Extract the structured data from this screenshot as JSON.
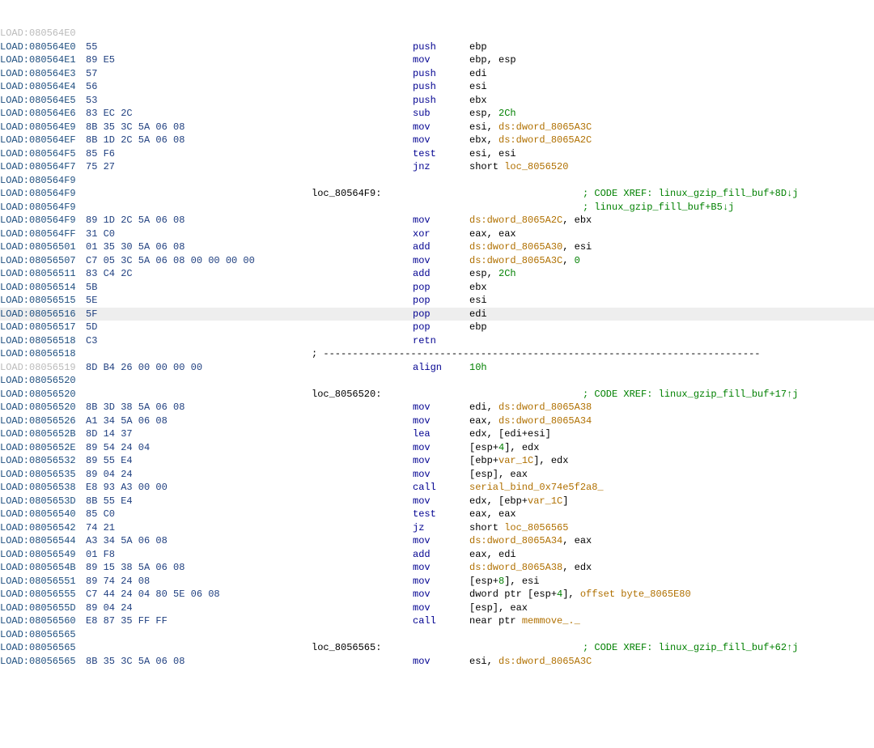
{
  "segPrefix": "LOAD:",
  "highlightIndex": 21,
  "columns": {
    "hex": 100,
    "label": 385,
    "mnem": 510,
    "ops": 580
  },
  "lines": [
    {
      "addr": "080564E0",
      "ghost": true
    },
    {
      "addr": "080564E0",
      "hex": "55",
      "mnem": "push",
      "ops": [
        {
          "t": "ebp"
        }
      ]
    },
    {
      "addr": "080564E1",
      "hex": "89 E5",
      "mnem": "mov",
      "ops": [
        {
          "t": "ebp, esp"
        }
      ]
    },
    {
      "addr": "080564E3",
      "hex": "57",
      "mnem": "push",
      "ops": [
        {
          "t": "edi"
        }
      ]
    },
    {
      "addr": "080564E4",
      "hex": "56",
      "mnem": "push",
      "ops": [
        {
          "t": "esi"
        }
      ]
    },
    {
      "addr": "080564E5",
      "hex": "53",
      "mnem": "push",
      "ops": [
        {
          "t": "ebx"
        }
      ]
    },
    {
      "addr": "080564E6",
      "hex": "83 EC 2C",
      "mnem": "sub",
      "ops": [
        {
          "t": "esp, "
        },
        {
          "t": "2Ch",
          "c": "num"
        }
      ]
    },
    {
      "addr": "080564E9",
      "hex": "8B 35 3C 5A 06 08",
      "mnem": "mov",
      "ops": [
        {
          "t": "esi, "
        },
        {
          "t": "ds:dword_8065A3C",
          "c": "ref"
        }
      ]
    },
    {
      "addr": "080564EF",
      "hex": "8B 1D 2C 5A 06 08",
      "mnem": "mov",
      "ops": [
        {
          "t": "ebx, "
        },
        {
          "t": "ds:dword_8065A2C",
          "c": "ref"
        }
      ]
    },
    {
      "addr": "080564F5",
      "hex": "85 F6",
      "mnem": "test",
      "ops": [
        {
          "t": "esi, esi"
        }
      ]
    },
    {
      "addr": "080564F7",
      "hex": "75 27",
      "mnem": "jnz",
      "ops": [
        {
          "t": "short "
        },
        {
          "t": "loc_8056520",
          "c": "ref"
        }
      ]
    },
    {
      "addr": "080564F9"
    },
    {
      "addr": "080564F9",
      "label": "loc_80564F9:",
      "cmt": "; CODE XREF: linux_gzip_fill_buf+8D↓j",
      "cmtcol": 720
    },
    {
      "addr": "080564F9",
      "cmt": "; linux_gzip_fill_buf+B5↓j",
      "cmtcol": 720
    },
    {
      "addr": "080564F9",
      "hex": "89 1D 2C 5A 06 08",
      "mnem": "mov",
      "ops": [
        {
          "t": "ds:dword_8065A2C",
          "c": "ref"
        },
        {
          "t": ", ebx"
        }
      ]
    },
    {
      "addr": "080564FF",
      "hex": "31 C0",
      "mnem": "xor",
      "ops": [
        {
          "t": "eax, eax"
        }
      ]
    },
    {
      "addr": "08056501",
      "hex": "01 35 30 5A 06 08",
      "mnem": "add",
      "ops": [
        {
          "t": "ds:dword_8065A30",
          "c": "ref"
        },
        {
          "t": ", esi"
        }
      ]
    },
    {
      "addr": "08056507",
      "hex": "C7 05 3C 5A 06 08 00 00 00 00",
      "mnem": "mov",
      "ops": [
        {
          "t": "ds:dword_8065A3C",
          "c": "ref"
        },
        {
          "t": ", "
        },
        {
          "t": "0",
          "c": "num"
        }
      ]
    },
    {
      "addr": "08056511",
      "hex": "83 C4 2C",
      "mnem": "add",
      "ops": [
        {
          "t": "esp, "
        },
        {
          "t": "2Ch",
          "c": "num"
        }
      ]
    },
    {
      "addr": "08056514",
      "hex": "5B",
      "mnem": "pop",
      "ops": [
        {
          "t": "ebx"
        }
      ]
    },
    {
      "addr": "08056515",
      "hex": "5E",
      "mnem": "pop",
      "ops": [
        {
          "t": "esi"
        }
      ]
    },
    {
      "addr": "08056516",
      "hex": "5F",
      "mnem": "pop",
      "ops": [
        {
          "t": "edi"
        }
      ]
    },
    {
      "addr": "08056517",
      "hex": "5D",
      "mnem": "pop",
      "ops": [
        {
          "t": "ebp"
        }
      ]
    },
    {
      "addr": "08056518",
      "hex": "C3",
      "mnem": "retn"
    },
    {
      "addr": "08056518",
      "label": "; ---------------------------------------------------------------------------"
    },
    {
      "addr": "08056519",
      "ghost": true,
      "hex": "8D B4 26 00 00 00 00",
      "mnem": "align",
      "ops": [
        {
          "t": "10h",
          "c": "num"
        }
      ]
    },
    {
      "addr": "08056520"
    },
    {
      "addr": "08056520",
      "label": "loc_8056520:",
      "cmt": "; CODE XREF: linux_gzip_fill_buf+17↑j",
      "cmtcol": 720
    },
    {
      "addr": "08056520",
      "hex": "8B 3D 38 5A 06 08",
      "mnem": "mov",
      "ops": [
        {
          "t": "edi, "
        },
        {
          "t": "ds:dword_8065A38",
          "c": "ref"
        }
      ]
    },
    {
      "addr": "08056526",
      "hex": "A1 34 5A 06 08",
      "mnem": "mov",
      "ops": [
        {
          "t": "eax, "
        },
        {
          "t": "ds:dword_8065A34",
          "c": "ref"
        }
      ]
    },
    {
      "addr": "0805652B",
      "hex": "8D 14 37",
      "mnem": "lea",
      "ops": [
        {
          "t": "edx, [edi+esi]"
        }
      ]
    },
    {
      "addr": "0805652E",
      "hex": "89 54 24 04",
      "mnem": "mov",
      "ops": [
        {
          "t": "[esp+"
        },
        {
          "t": "4",
          "c": "num"
        },
        {
          "t": "], edx"
        }
      ]
    },
    {
      "addr": "08056532",
      "hex": "89 55 E4",
      "mnem": "mov",
      "ops": [
        {
          "t": "[ebp+"
        },
        {
          "t": "var_1C",
          "c": "ref"
        },
        {
          "t": "], edx"
        }
      ]
    },
    {
      "addr": "08056535",
      "hex": "89 04 24",
      "mnem": "mov",
      "ops": [
        {
          "t": "[esp], eax"
        }
      ]
    },
    {
      "addr": "08056538",
      "hex": "E8 93 A3 00 00",
      "mnem": "call",
      "ops": [
        {
          "t": "serial_bind_0x74e5f2a8_",
          "c": "ref"
        }
      ]
    },
    {
      "addr": "0805653D",
      "hex": "8B 55 E4",
      "mnem": "mov",
      "ops": [
        {
          "t": "edx, [ebp+"
        },
        {
          "t": "var_1C",
          "c": "ref"
        },
        {
          "t": "]"
        }
      ]
    },
    {
      "addr": "08056540",
      "hex": "85 C0",
      "mnem": "test",
      "ops": [
        {
          "t": "eax, eax"
        }
      ]
    },
    {
      "addr": "08056542",
      "hex": "74 21",
      "mnem": "jz",
      "ops": [
        {
          "t": "short "
        },
        {
          "t": "loc_8056565",
          "c": "ref"
        }
      ]
    },
    {
      "addr": "08056544",
      "hex": "A3 34 5A 06 08",
      "mnem": "mov",
      "ops": [
        {
          "t": "ds:dword_8065A34",
          "c": "ref"
        },
        {
          "t": ", eax"
        }
      ]
    },
    {
      "addr": "08056549",
      "hex": "01 F8",
      "mnem": "add",
      "ops": [
        {
          "t": "eax, edi"
        }
      ]
    },
    {
      "addr": "0805654B",
      "hex": "89 15 38 5A 06 08",
      "mnem": "mov",
      "ops": [
        {
          "t": "ds:dword_8065A38",
          "c": "ref"
        },
        {
          "t": ", edx"
        }
      ]
    },
    {
      "addr": "08056551",
      "hex": "89 74 24 08",
      "mnem": "mov",
      "ops": [
        {
          "t": "[esp+"
        },
        {
          "t": "8",
          "c": "num"
        },
        {
          "t": "], esi"
        }
      ]
    },
    {
      "addr": "08056555",
      "hex": "C7 44 24 04 80 5E 06 08",
      "mnem": "mov",
      "ops": [
        {
          "t": "dword ptr [esp+"
        },
        {
          "t": "4",
          "c": "num"
        },
        {
          "t": "], "
        },
        {
          "t": "offset byte_8065E80",
          "c": "ref"
        }
      ]
    },
    {
      "addr": "0805655D",
      "hex": "89 04 24",
      "mnem": "mov",
      "ops": [
        {
          "t": "[esp], eax"
        }
      ]
    },
    {
      "addr": "08056560",
      "hex": "E8 87 35 FF FF",
      "mnem": "call",
      "ops": [
        {
          "t": "near ptr "
        },
        {
          "t": "memmove_._",
          "c": "ref"
        }
      ]
    },
    {
      "addr": "08056565"
    },
    {
      "addr": "08056565",
      "label": "loc_8056565:",
      "cmt": "; CODE XREF: linux_gzip_fill_buf+62↑j",
      "cmtcol": 720
    },
    {
      "addr": "08056565",
      "hex": "8B 35 3C 5A 06 08",
      "mnem": "mov",
      "ops": [
        {
          "t": "esi, "
        },
        {
          "t": "ds:dword_8065A3C",
          "c": "ref"
        }
      ]
    }
  ]
}
